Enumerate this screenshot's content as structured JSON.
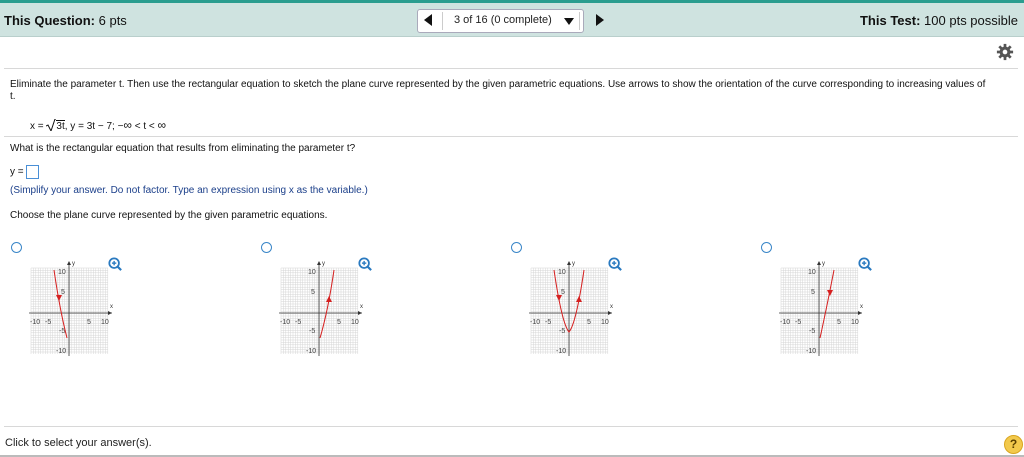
{
  "header": {
    "question_label": "This Question:",
    "question_pts": "6 pts",
    "nav_text": "3 of 16 (0 complete)",
    "test_label": "This Test:",
    "test_pts": "100 pts possible"
  },
  "question": {
    "instruction": "Eliminate the parameter t. Then use the rectangular equation to sketch the plane curve represented by the given parametric equations. Use arrows to show the orientation of the curve corresponding to increasing values of t.",
    "x_eq_lhs": "x =",
    "x_eq_sqrt": "3t",
    "y_eq": ", y = 3t − 7;",
    "t_range_start": "−",
    "t_range_mid": "< t <",
    "infinity": "∞",
    "ask": "What is the rectangular equation that results from eliminating the parameter t?",
    "answer_prefix": "y =",
    "answer_value": "",
    "hint": "(Simplify your answer. Do not factor. Type an expression using x as the variable.)",
    "choose": "Choose the plane curve represented by the given parametric equations."
  },
  "graph_labels": {
    "y": "y",
    "x": "x",
    "t10": "10",
    "t5": "5",
    "tn5": "-5",
    "tn10": "-10"
  },
  "footer": {
    "prompt": "Click to select your answer(s).",
    "help": "?"
  },
  "colors": {
    "accent": "#2a9d8f",
    "header_bg": "#cfe3e0",
    "curve": "#d62020",
    "link_blue": "#1b3f8a"
  },
  "icons": [
    "gear-icon",
    "zoom-in-icon",
    "help-icon",
    "prev-arrow-icon",
    "next-arrow-icon",
    "dropdown-icon"
  ]
}
